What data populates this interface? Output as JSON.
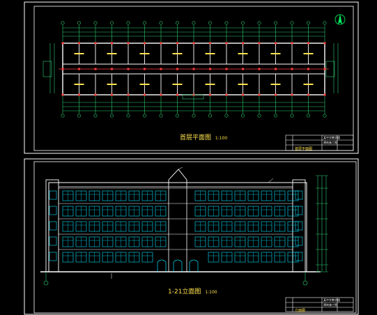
{
  "sheet_top": {
    "title": "首层平面图",
    "scale": "1:100",
    "title_block": [
      "某中学教学楼",
      "建筑施工图",
      "首层平面图"
    ]
  },
  "sheet_bottom": {
    "title": "1-21立面图",
    "scale": "1:100",
    "title_block": [
      "某中学教学楼",
      "建筑施工图",
      "立面图"
    ]
  },
  "colors": {
    "frame": "#ffffff",
    "dim": "#2ecc71",
    "wall": "#ffffff",
    "axis": "#ff3b3b",
    "room_text": "#ffe34d",
    "window": "#00e5ff",
    "sheet_border": "#00e5ff"
  },
  "icons": [
    "north-arrow-icon",
    "door-symbol-icon",
    "window-icon"
  ]
}
